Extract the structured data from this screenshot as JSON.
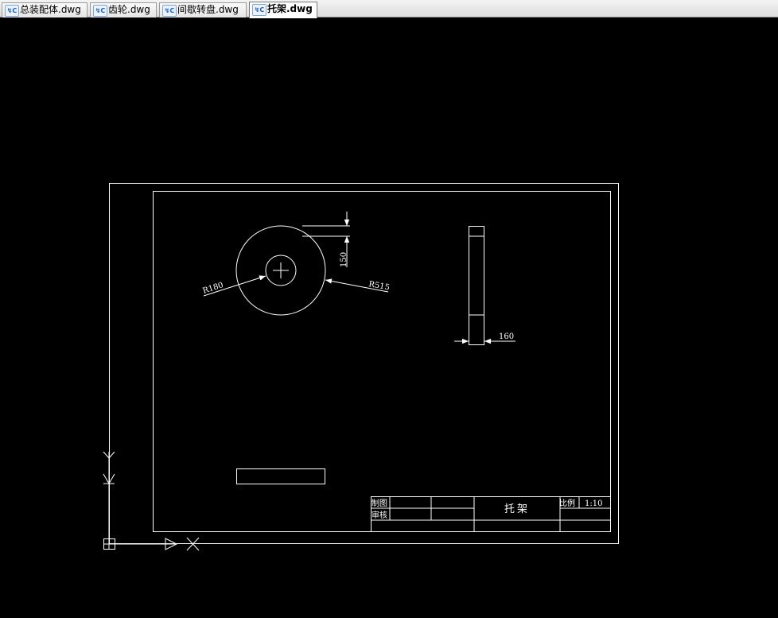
{
  "tabs": [
    {
      "label": "总装配体.dwg",
      "active": false
    },
    {
      "label": "齿轮.dwg",
      "active": false
    },
    {
      "label": "间歇转盘.dwg",
      "active": false
    },
    {
      "label": "托架.dwg",
      "active": true
    }
  ],
  "tab_icon": "cad-file-icon",
  "drawing": {
    "background": "#000000",
    "line_color": "#ffffff",
    "dimensions": {
      "r_inner": "R180",
      "r_outer": "R515",
      "height": "150",
      "width": "160"
    },
    "title_block": {
      "drawn_by_label": "制图",
      "checked_by_label": "审核",
      "part_name": "托架",
      "scale_label": "比例",
      "scale_value": "1:10"
    }
  }
}
